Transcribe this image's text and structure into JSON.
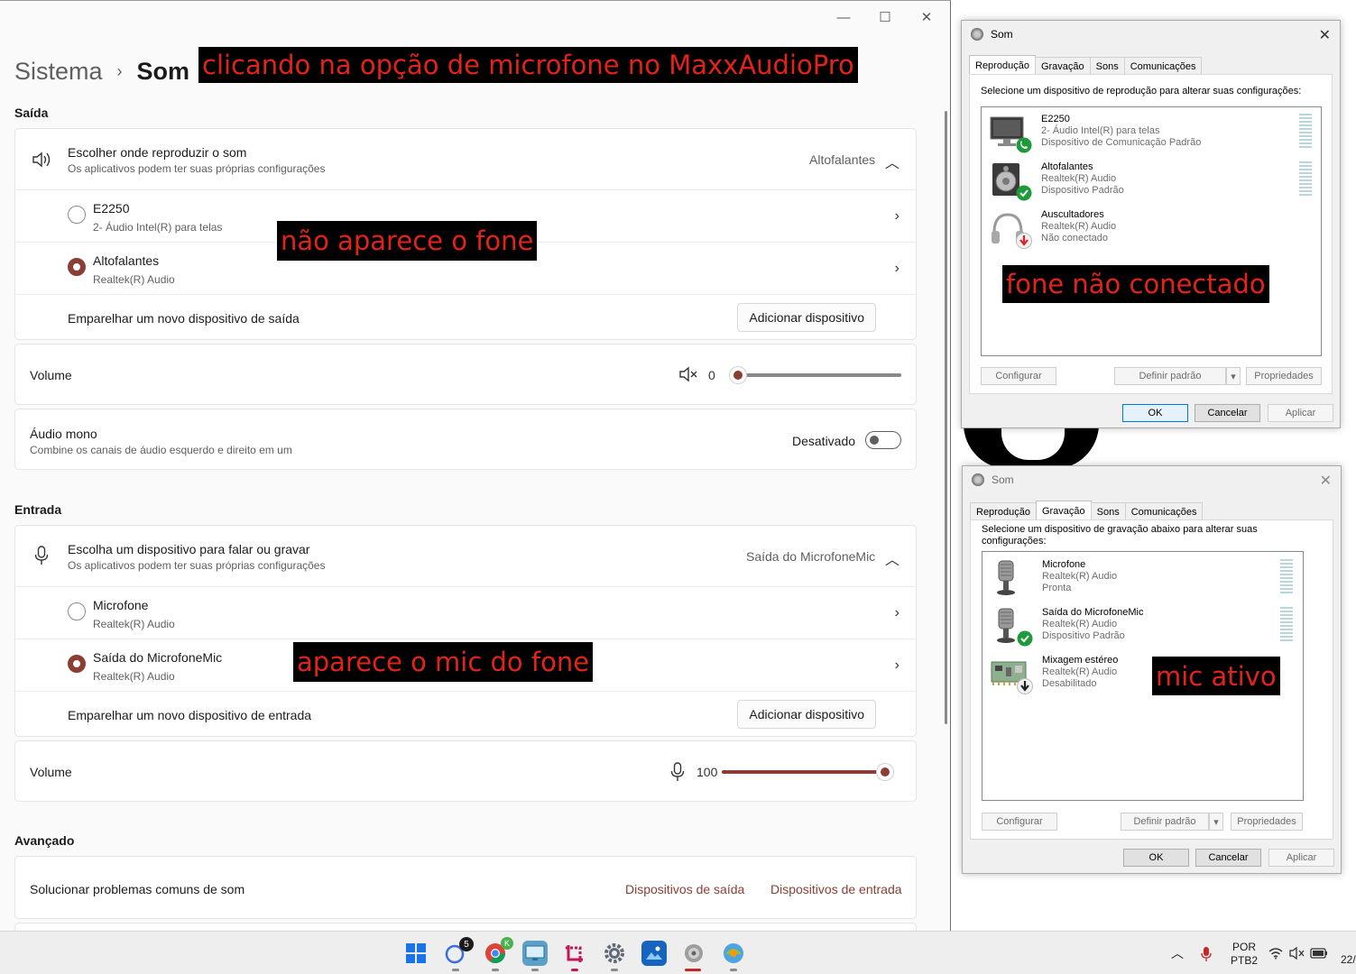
{
  "settings": {
    "breadcrumb_parent": "Sistema",
    "breadcrumb_sep": "›",
    "breadcrumb_current": "Som",
    "win_min": "—",
    "win_max": "☐",
    "win_close": "✕",
    "output": {
      "heading": "Saída",
      "choose_title": "Escolher onde reproduzir o som",
      "choose_sub": "Os aplicativos podem ter suas próprias configurações",
      "current_device": "Altofalantes",
      "devices": [
        {
          "name": "E2250",
          "sub": "2- Áudio Intel(R) para telas",
          "selected": false
        },
        {
          "name": "Altofalantes",
          "sub": "Realtek(R) Audio",
          "selected": true
        }
      ],
      "pair_label": "Emparelhar um novo dispositivo de saída",
      "add_button": "Adicionar dispositivo",
      "volume_label": "Volume",
      "volume_value": "0",
      "volume_level": 0,
      "mono_title": "Áudio mono",
      "mono_sub": "Combine os canais de áudio esquerdo e direito em um",
      "mono_state": "Desativado"
    },
    "input": {
      "heading": "Entrada",
      "choose_title": "Escolha um dispositivo para falar ou gravar",
      "choose_sub": "Os aplicativos podem ter suas próprias configurações",
      "current_device": "Saída do MicrofoneMic",
      "devices": [
        {
          "name": "Microfone",
          "sub": "Realtek(R) Audio",
          "selected": false
        },
        {
          "name": "Saída do MicrofoneMic",
          "sub": "Realtek(R) Audio",
          "selected": true
        }
      ],
      "pair_label": "Emparelhar um novo dispositivo de entrada",
      "add_button": "Adicionar dispositivo",
      "volume_label": "Volume",
      "volume_value": "100",
      "volume_level": 100
    },
    "advanced": {
      "heading": "Avançado",
      "troubleshoot": "Solucionar problemas comuns de som",
      "link_output": "Dispositivos de saída",
      "link_input": "Dispositivos de entrada"
    },
    "accent": "#8a3e35"
  },
  "annotations": {
    "top": "clicando na opção de microfone no MaxxAudioPro",
    "no_headset": "não aparece o fone",
    "mic_appears": "aparece o mic do fone",
    "not_connected": "fone não conectado",
    "mic_active": "mic ativo"
  },
  "playback_dialog": {
    "title": "Som",
    "tabs": [
      "Reprodução",
      "Gravação",
      "Sons",
      "Comunicações"
    ],
    "active_tab": 0,
    "prompt": "Selecione um dispositivo de reprodução para alterar suas configurações:",
    "devices": [
      {
        "name": "E2250",
        "line1": "2- Áudio Intel(R) para telas",
        "line2": "Dispositivo de Comunicação Padrão",
        "icon": "monitor-icon",
        "badge": "phone-check"
      },
      {
        "name": "Altofalantes",
        "line1": "Realtek(R) Audio",
        "line2": "Dispositivo Padrão",
        "icon": "speaker-icon",
        "badge": "check"
      },
      {
        "name": "Auscultadores",
        "line1": "Realtek(R) Audio",
        "line2": "Não conectado",
        "icon": "headphones-icon",
        "badge": "down-red"
      }
    ],
    "btn_configure": "Configurar",
    "btn_default": "Definir padrão",
    "btn_props": "Propriedades",
    "btn_ok": "OK",
    "btn_cancel": "Cancelar",
    "btn_apply": "Aplicar"
  },
  "recording_dialog": {
    "title": "Som",
    "tabs": [
      "Reprodução",
      "Gravação",
      "Sons",
      "Comunicações"
    ],
    "active_tab": 1,
    "prompt_1": "Selecione um dispositivo de gravação abaixo para alterar suas",
    "prompt_2": "configurações:",
    "devices": [
      {
        "name": "Microfone",
        "line1": "Realtek(R) Audio",
        "line2": "Pronta",
        "icon": "microphone-icon",
        "badge": ""
      },
      {
        "name": "Saída do MicrofoneMic",
        "line1": "Realtek(R) Audio",
        "line2": "Dispositivo Padrão",
        "icon": "microphone-icon",
        "badge": "check"
      },
      {
        "name": "Mixagem estéreo",
        "line1": "Realtek(R) Audio",
        "line2": "Desabilitado",
        "icon": "circuit-board-icon",
        "badge": "down-black"
      }
    ],
    "btn_configure": "Configurar",
    "btn_default": "Definir padrão",
    "btn_props": "Propriedades",
    "btn_ok": "OK",
    "btn_cancel": "Cancelar",
    "btn_apply": "Aplicar"
  },
  "taskbar": {
    "chat_badge": "5",
    "chrome_badge": "K",
    "lang_1": "POR",
    "lang_2": "PTB2",
    "clock": "22/"
  }
}
